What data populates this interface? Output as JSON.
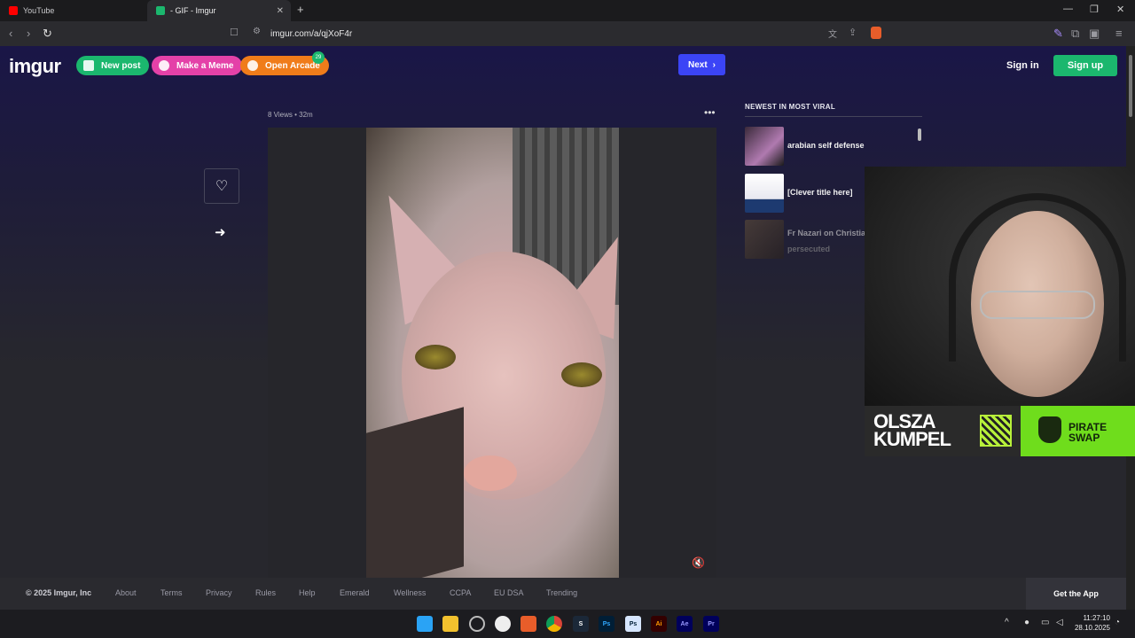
{
  "browser": {
    "tabs": [
      {
        "label": "YouTube",
        "active": false,
        "favicon_color": "#ff0000"
      },
      {
        "label": "- GIF - Imgur",
        "active": true,
        "favicon_color": "#1bb76e"
      }
    ],
    "url": "imgur.com/a/qjXoF4r"
  },
  "header": {
    "logo": "imgur",
    "new_post": "New post",
    "make_meme": "Make a Meme",
    "open_arcade": "Open Arcade",
    "arcade_badge": "29",
    "next": "Next",
    "sign_in": "Sign in",
    "sign_up": "Sign up"
  },
  "post": {
    "meta": "8 Views • 32m"
  },
  "viral": {
    "heading": "NEWEST IN MOST VIRAL",
    "items": [
      {
        "title": "arabian self defense",
        "sub": ""
      },
      {
        "title": "[Clever title here]",
        "sub": ""
      },
      {
        "title": "Fr Nazari on Christia",
        "sub": "persecuted"
      }
    ]
  },
  "overlay": {
    "sponsor1": "OLSZA KUMPEL",
    "sponsor2": "PIRATE SWAP"
  },
  "footer": {
    "copyright": "© 2025 Imgur, Inc",
    "links": [
      "About",
      "Terms",
      "Privacy",
      "Rules",
      "Help",
      "Emerald",
      "Wellness",
      "CCPA",
      "EU DSA",
      "Trending"
    ],
    "get_app": "Get the App"
  },
  "taskbar": {
    "time": "11:27:10",
    "date": "28.10.2025"
  },
  "colors": {
    "green": "#1bb76e",
    "pink": "#e441a8",
    "orange": "#f07c1a",
    "next_blue": "#3b44f6"
  }
}
